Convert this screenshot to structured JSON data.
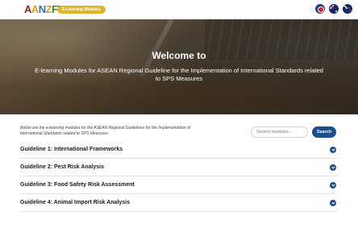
{
  "header": {
    "logo_text": "AANZFTA",
    "badge": "E-Learning Modules",
    "flags": [
      "asean-flag-icon",
      "australia-flag-icon",
      "new-zealand-flag-icon"
    ]
  },
  "hero": {
    "title": "Welcome to",
    "subtitle": "E-learning Modules for ASEAN Regional Guideline for the Implementation of International Standards related to SPS Measures"
  },
  "main": {
    "intro": "Below are the e-learning modules for the ASEAN Regional Guidelines for the Implementation of International Standards related to SPS Measures:",
    "search": {
      "placeholder": "Search modules...",
      "button_label": "Search"
    },
    "guidelines": [
      {
        "title": "Guideline 1: International Frameworks"
      },
      {
        "title": "Guideline 2: Pest Risk Analysis"
      },
      {
        "title": "Guideline 3: Food Safety Risk Assessment"
      },
      {
        "title": "Guideline 4: Animal Import Risk Analysis"
      }
    ]
  },
  "colors": {
    "accent": "#1d4e8f",
    "badge": "#e3b42a",
    "logo_red": "#8b2a1c"
  }
}
